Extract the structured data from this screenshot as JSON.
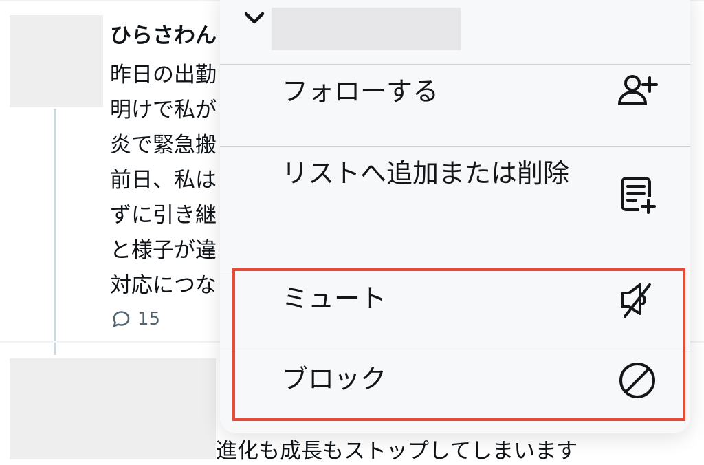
{
  "tweet": {
    "author": "ひらさわん",
    "text_lines": [
      "昨日の出勤",
      "明けで私が",
      "炎で緊急搬",
      "前日、私は",
      "ずに引き継",
      "と様子が違",
      "対応につな"
    ],
    "reply_count": "15"
  },
  "next_tweet": {
    "text": "進化も成長もストップしてしまいます"
  },
  "menu": {
    "collapse_icon": "chevron-down-icon",
    "items": [
      {
        "label": "フォローする",
        "icon": "follow-user-icon"
      },
      {
        "label": "リストへ追加または削除",
        "icon": "list-add-icon"
      },
      {
        "label": "ミュート",
        "icon": "mute-speaker-icon"
      },
      {
        "label": "ブロック",
        "icon": "block-icon"
      }
    ]
  },
  "colors": {
    "highlight": "#e84a37",
    "menu_background": "#f7f8fa",
    "text": "#14171a",
    "secondary_text": "#536471"
  }
}
